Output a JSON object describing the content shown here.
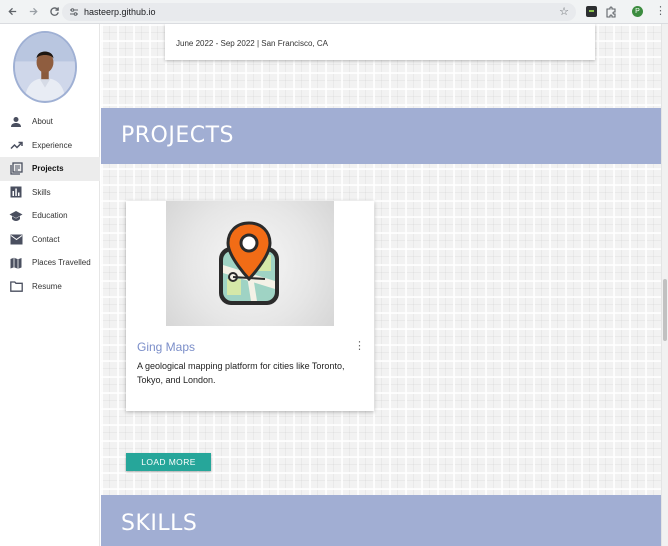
{
  "browser": {
    "url": "hasteerp.github.io",
    "profile_initial": "P",
    "icons": [
      "back-arrow-icon",
      "forward-arrow-icon",
      "reload-icon",
      "site-info-icon",
      "bookmark-star-icon",
      "extension-icon",
      "puzzle-icon",
      "more-vert-icon"
    ]
  },
  "sidebar": {
    "items": [
      {
        "label": "About",
        "icon": "person-icon",
        "active": false
      },
      {
        "label": "Experience",
        "icon": "trending-up-icon",
        "active": false
      },
      {
        "label": "Projects",
        "icon": "library-books-icon",
        "active": true
      },
      {
        "label": "Skills",
        "icon": "bar-chart-icon",
        "active": false
      },
      {
        "label": "Education",
        "icon": "school-icon",
        "active": false
      },
      {
        "label": "Contact",
        "icon": "mail-icon",
        "active": false
      },
      {
        "label": "Places Travelled",
        "icon": "map-icon",
        "active": false
      },
      {
        "label": "Resume",
        "icon": "folder-icon",
        "active": false
      }
    ]
  },
  "experience": {
    "dates": "June 2022 - Sep 2022 | San Francisco, CA"
  },
  "projects": {
    "heading": "PROJECTS",
    "items": [
      {
        "title": "Ging Maps",
        "description": "A geological mapping platform for cities like Toronto, Tokyo, and London.",
        "icon": "map-pin-app-icon"
      }
    ],
    "load_more_label": "LOAD MORE"
  },
  "skills": {
    "heading": "SKILLS"
  },
  "colors": {
    "banner": "#a1aed3",
    "accent_button": "#26a69a",
    "project_title": "#7b8ec9",
    "pin_orange": "#f26c16"
  }
}
